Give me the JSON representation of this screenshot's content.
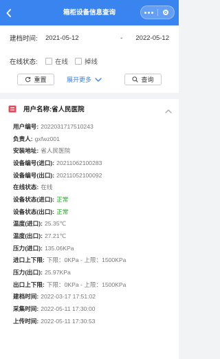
{
  "header": {
    "title": "箱柜设备信息查询"
  },
  "filter": {
    "date_label": "建档时间:",
    "date_start": "2021-05-12",
    "date_separator": "-",
    "date_end": "2022-05-12",
    "status_label": "在线状态:",
    "options": [
      {
        "label": "在线",
        "checked": false
      },
      {
        "label": "掉线",
        "checked": false
      }
    ],
    "reset_label": "重置",
    "expand_label": "展开更多",
    "search_label": "查询"
  },
  "card": {
    "header_label": "用户名称:",
    "header_value": "省人民医院",
    "fields": [
      {
        "key": "用户编号:",
        "value": "2022031717510243"
      },
      {
        "key": "负责人:",
        "value": "gxfwz001"
      },
      {
        "key": "安装地址:",
        "value": "省人民医院"
      },
      {
        "key": "设备编号(进口):",
        "value": "20211062100283"
      },
      {
        "key": "设备编号(出口):",
        "value": "20211052100092"
      },
      {
        "key": "在线状态:",
        "value": "在线"
      },
      {
        "key": "设备状态(进口):",
        "value": "正常",
        "color": "#1aad19"
      },
      {
        "key": "设备状态(出口):",
        "value": "正常",
        "color": "#1aad19"
      },
      {
        "key": "温度(进口):",
        "value": "25.35℃"
      },
      {
        "key": "温度(出口):",
        "value": "27.21℃"
      },
      {
        "key": "压力(进口):",
        "value": "135.06KPa"
      },
      {
        "key": "进口上下限:",
        "value": "下限：0KPa - 上限：1500KPa"
      },
      {
        "key": "压力(出口):",
        "value": "25.97KPa"
      },
      {
        "key": "出口上下限:",
        "value": "下限：0KPa - 上限：1500KPa"
      },
      {
        "key": "建档时间:",
        "value": "2022-03-17 17:51:02"
      },
      {
        "key": "采集时间:",
        "value": "2022-05-11 17:30:00"
      },
      {
        "key": "上传时间:",
        "value": "2022-05-11 17:30:53"
      }
    ]
  },
  "colors": {
    "primary": "#3a84f0",
    "ok": "#1aad19",
    "icon": "#e8485a"
  },
  "icons": [
    "back-arrow-icon",
    "more-dots-icon",
    "close-circle-icon",
    "refresh-icon",
    "chevron-down-icon",
    "search-icon",
    "user-card-icon",
    "chevron-up-icon"
  ]
}
